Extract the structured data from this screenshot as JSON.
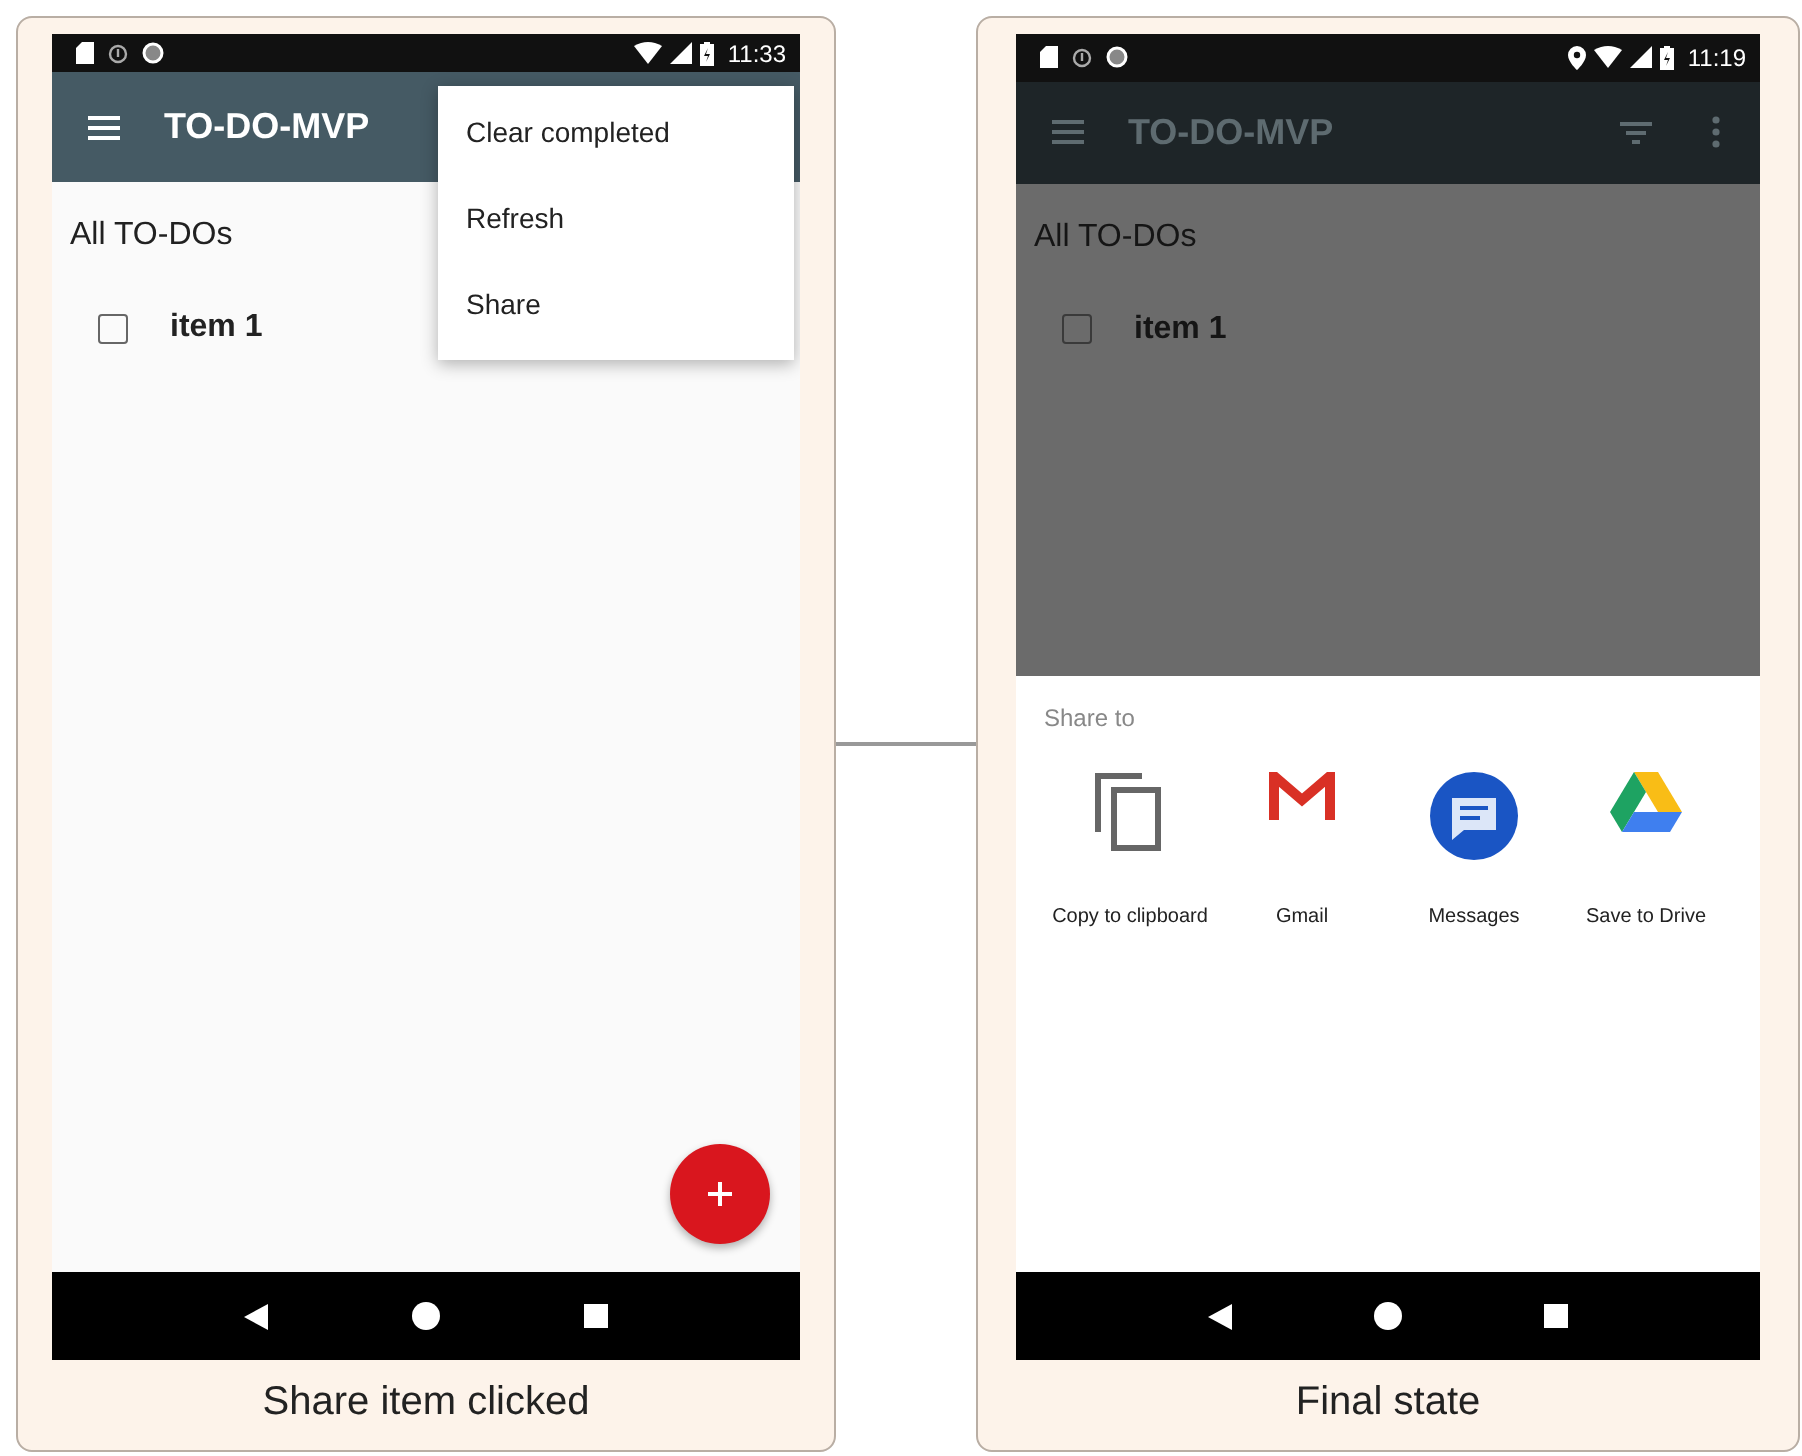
{
  "screens": [
    {
      "caption": "Share item clicked",
      "status": {
        "time": "11:33",
        "location": false
      },
      "app_bar": {
        "title": "TO-DO-MVP"
      },
      "dimmed": false,
      "list": {
        "title": "All TO-DOs",
        "items": [
          {
            "label": "item 1",
            "checked": false
          }
        ]
      },
      "overflow_menu": [
        "Clear completed",
        "Refresh",
        "Share"
      ]
    },
    {
      "caption": "Final state",
      "status": {
        "time": "11:19",
        "location": true
      },
      "app_bar": {
        "title": "TO-DO-MVP"
      },
      "dimmed": true,
      "list": {
        "title": "All TO-DOs",
        "items": [
          {
            "label": "item 1",
            "checked": false
          }
        ]
      },
      "share_sheet": {
        "title": "Share to",
        "targets": [
          {
            "label": "Copy to clipboard",
            "kind": "clipboard"
          },
          {
            "label": "Gmail",
            "kind": "gmail"
          },
          {
            "label": "Messages",
            "kind": "messages"
          },
          {
            "label": "Save to Drive",
            "kind": "drive"
          }
        ]
      }
    }
  ]
}
